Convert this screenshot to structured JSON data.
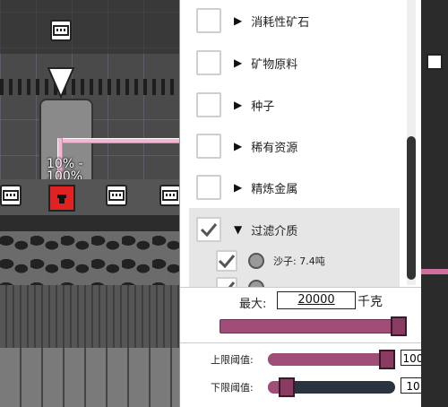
{
  "world": {
    "pct_label": "10% -\n100%",
    "colors": {
      "pipe": "#f3b6d3",
      "grid": "#9a8ee0",
      "selected_building": "#d42020"
    }
  },
  "filter_list": {
    "items": [
      {
        "label": "消耗性矿石",
        "checked": false,
        "expanded": false
      },
      {
        "label": "矿物原料",
        "checked": false,
        "expanded": false
      },
      {
        "label": "种子",
        "checked": false,
        "expanded": false
      },
      {
        "label": "稀有资源",
        "checked": false,
        "expanded": false
      },
      {
        "label": "精炼金属",
        "checked": false,
        "expanded": false
      },
      {
        "label": "过滤介质",
        "checked": true,
        "expanded": true
      }
    ],
    "sub_items": [
      {
        "label": "沙子: 7.4吨",
        "checked": true
      },
      {
        "label": "",
        "checked": true
      }
    ]
  },
  "capacity": {
    "max_label": "最大:",
    "max_value": "20000",
    "unit": "千克",
    "fill_fraction": 1.0
  },
  "thresholds": {
    "upper": {
      "label": "上限阈值:",
      "value": "100",
      "fraction": 1.0
    },
    "lower": {
      "label": "下限阈值:",
      "value": "10",
      "fraction": 0.1
    }
  },
  "icons": {
    "expand": "▶",
    "collapse": "▼",
    "check": "check-icon",
    "conveyor": "conveyor-icon"
  }
}
